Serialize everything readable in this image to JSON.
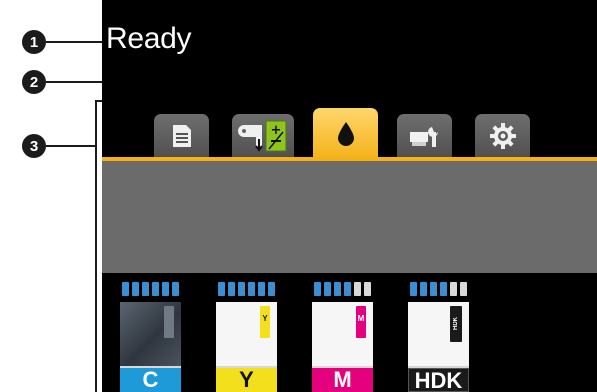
{
  "callouts": [
    "1",
    "2",
    "3"
  ],
  "status": {
    "text": "Ready"
  },
  "tabs": [
    {
      "icon": "print-queue-icon",
      "active": false
    },
    {
      "icon": "media-feed-adjust-icon",
      "active": false,
      "badge": "±"
    },
    {
      "icon": "ink-drop-icon",
      "active": true
    },
    {
      "icon": "maintenance-icon",
      "active": false
    },
    {
      "icon": "settings-gear-icon",
      "active": false
    }
  ],
  "inks": [
    {
      "label": "C",
      "color": "#1e9ad9",
      "level_segments": 6,
      "filled_segments": 6,
      "strip_text": ""
    },
    {
      "label": "Y",
      "color": "#f3df1c",
      "level_segments": 6,
      "filled_segments": 6,
      "strip_text": "Y"
    },
    {
      "label": "M",
      "color": "#e5007e",
      "level_segments": 6,
      "filled_segments": 4,
      "strip_text": "M"
    },
    {
      "label": "HDK",
      "color": "#1a1a1a",
      "level_segments": 6,
      "filled_segments": 4,
      "strip_text": "HDK"
    }
  ],
  "colors": {
    "accent": "#f5b217",
    "level_fill": "#3a8fd0",
    "level_empty": "#d9d9d9"
  }
}
